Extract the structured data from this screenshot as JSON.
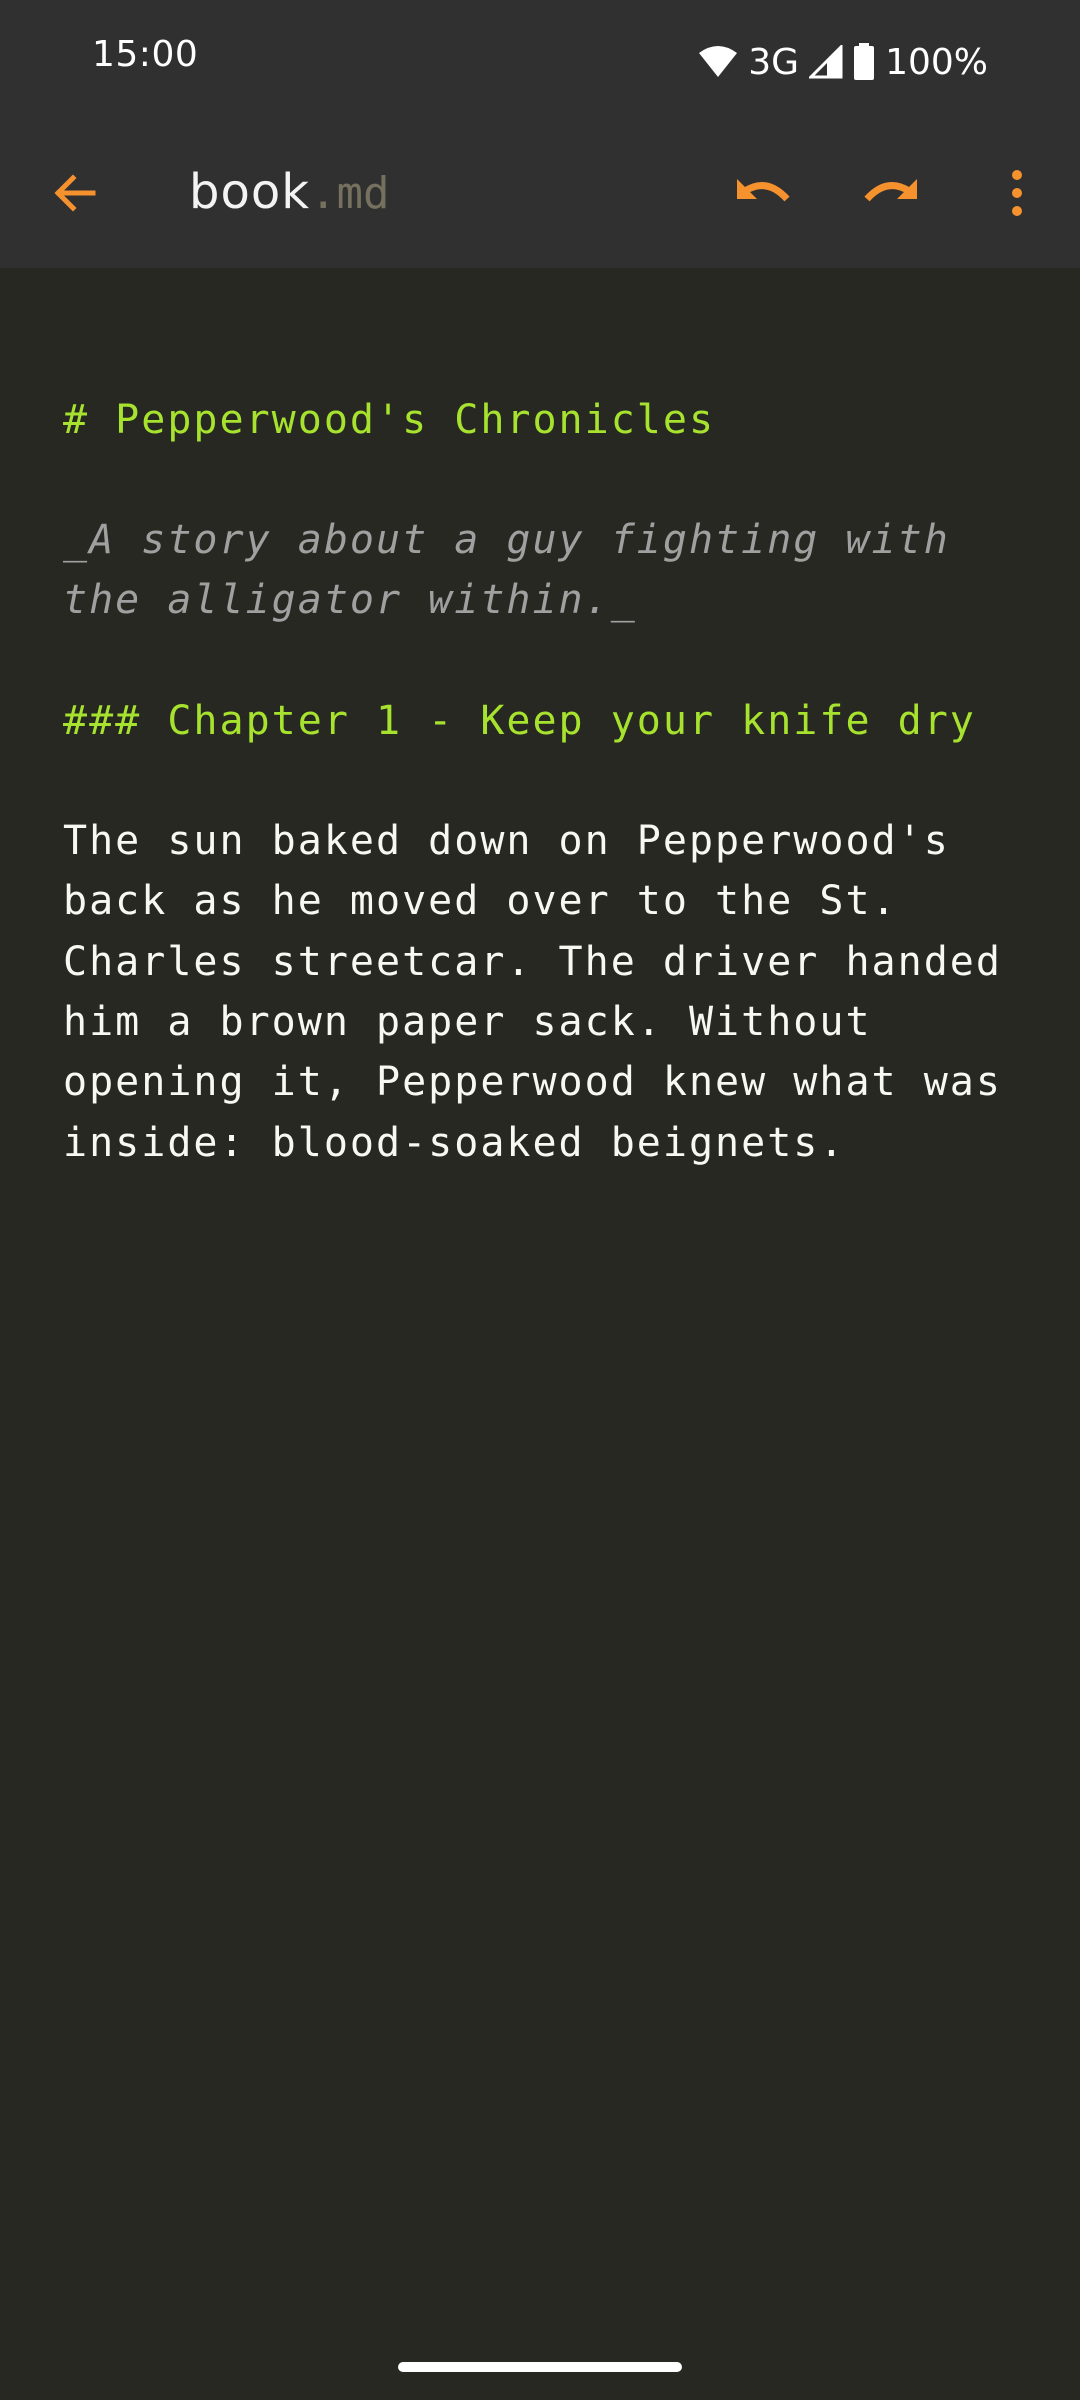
{
  "status_bar": {
    "time": "15:00",
    "network": "3G",
    "battery": "100%",
    "icons": [
      "wifi-icon",
      "signal-icon",
      "battery-icon"
    ]
  },
  "app_bar": {
    "file_name": "book",
    "file_ext": ".md",
    "icons": [
      "back-arrow-icon",
      "undo-icon",
      "redo-icon",
      "more-vert-icon"
    ],
    "accent_color": "#f5922e"
  },
  "editor": {
    "lines": [
      "# Pepperwood's Chronicles",
      "_A story about a guy fighting with",
      "the alligator within._",
      "### Chapter 1 - Keep your knife dry",
      "The sun baked down on Pepperwood's",
      "back as he moved over to the St.",
      "Charles streetcar. The driver handed",
      "him a brown paper sack. Without",
      "opening it, Pepperwood knew what was",
      "inside: blood-soaked beignets."
    ],
    "colors": {
      "background": "#272822",
      "heading": "#a6e22e",
      "italic": "#a0a0a0",
      "text": "#f8f8f2"
    }
  }
}
